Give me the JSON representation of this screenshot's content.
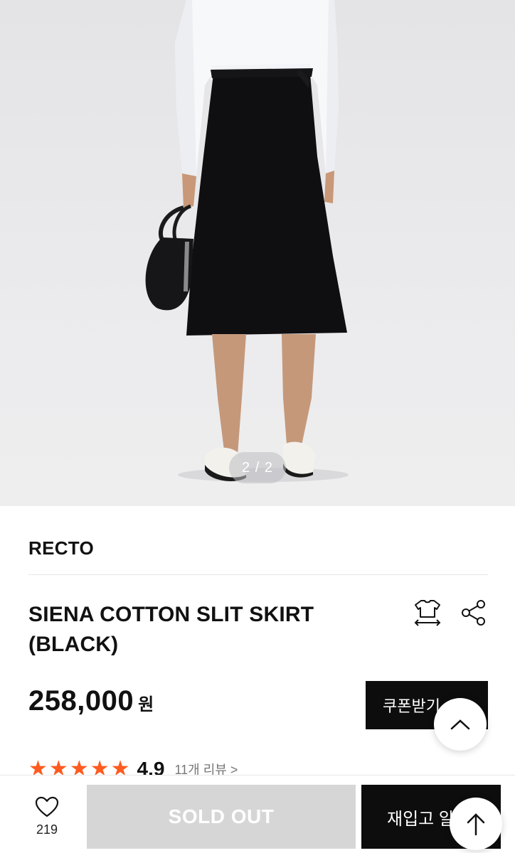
{
  "gallery": {
    "indicator": "2 / 2"
  },
  "product": {
    "brand": "RECTO",
    "title_line1": "SIENA COTTON SLIT SKIRT",
    "title_line2": "(BLACK)",
    "price": "258,000",
    "price_unit": "원",
    "coupon_label": "쿠폰받기",
    "rating_score": "4.9",
    "rating_stars": 5,
    "review_link": "11개 리뷰 >"
  },
  "icons": {
    "size_guide": "tshirt-size-icon",
    "share": "share-icon",
    "scroll_top": "arrow-up-icon",
    "like": "heart-icon",
    "star": "star-icon"
  },
  "colors": {
    "star": "#ff5a1f",
    "primary_button": "#0d0d0d",
    "disabled_button": "#d6d6d6"
  },
  "bottom_bar": {
    "like_count": "219",
    "soldout_label": "SOLD OUT",
    "restock_label": "재입고 알림"
  }
}
